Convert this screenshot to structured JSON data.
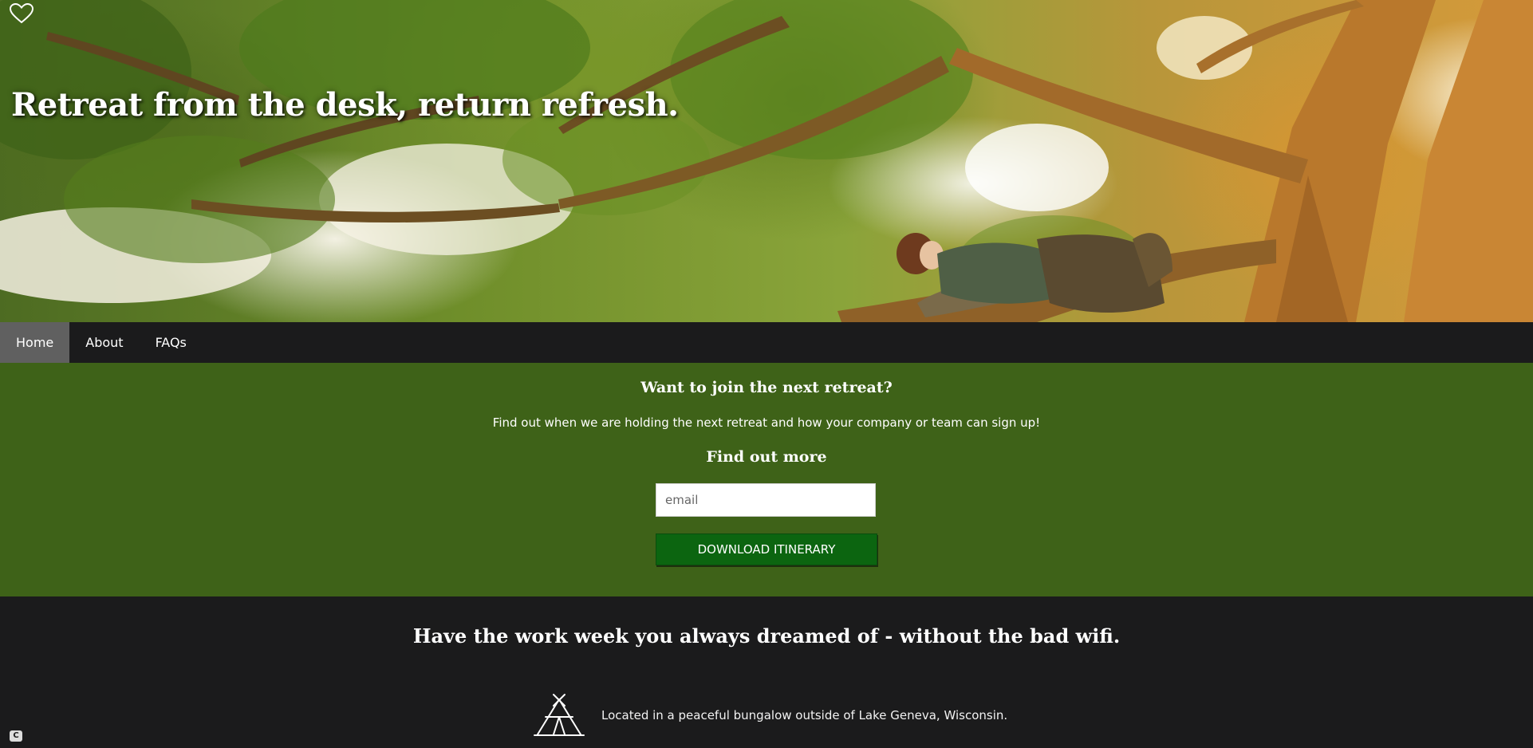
{
  "hero": {
    "title": "Retreat from the desk, return refresh.",
    "logo_icon": "heart-outline-icon"
  },
  "nav": {
    "items": [
      {
        "label": "Home",
        "active": true
      },
      {
        "label": "About",
        "active": false
      },
      {
        "label": "FAQs",
        "active": false
      }
    ]
  },
  "signup": {
    "heading": "Want to join the next retreat?",
    "description": "Find out when we are holding the next retreat and how your company or team can sign up!",
    "subheading": "Find out more",
    "email_placeholder": "email",
    "button_label": "DOWNLOAD ITINERARY"
  },
  "features": {
    "heading": "Have the work week you always dreamed of - without the bad wifi.",
    "items": [
      {
        "icon": "tent-icon",
        "text": "Located in a peaceful bungalow outside of Lake Geneva, Wisconsin."
      }
    ]
  },
  "corner_badge": {
    "label": "C"
  },
  "colors": {
    "nav_bg": "#1b1b1c",
    "nav_active": "#606060",
    "signup_bg": "#3e6218",
    "button_bg": "#0c6510",
    "dark_bg": "#1b1b1c"
  }
}
